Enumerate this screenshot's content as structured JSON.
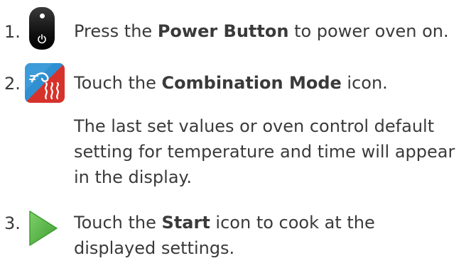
{
  "steps": [
    {
      "number": "1.",
      "icon": "power-button-icon",
      "prefix": "Press the ",
      "bold": "Power Button",
      "suffix": " to power oven on."
    },
    {
      "number": "2.",
      "icon": "combination-mode-icon",
      "prefix": "Touch the ",
      "bold": "Combination Mode",
      "suffix": " icon.",
      "note_lines": [
        "The last set values or oven control default",
        "setting for temperature and time will appear",
        "in the display."
      ]
    },
    {
      "number": "3.",
      "icon": "start-play-icon",
      "prefix": "Touch the ",
      "bold": "Start",
      "suffix": " icon to cook at the",
      "line2": "displayed settings."
    }
  ],
  "colors": {
    "text": "#3a3a3a",
    "power_icon": "#111111",
    "combo_blue": "#2f8fd0",
    "combo_red": "#d6322b",
    "start_green": "#5cb947"
  }
}
